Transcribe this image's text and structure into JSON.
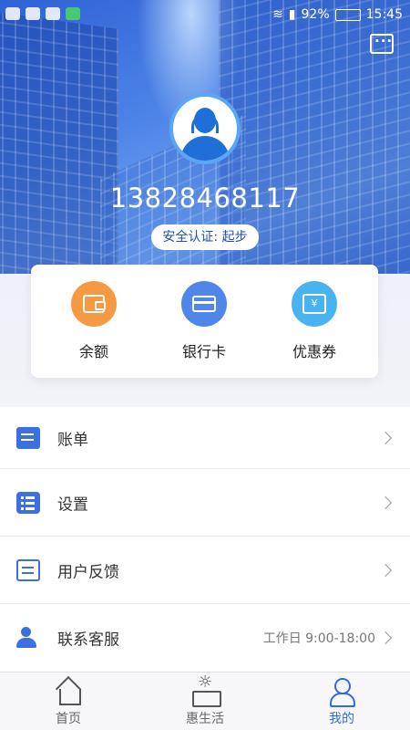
{
  "status_bar": {
    "battery": "92%",
    "time": "15:45"
  },
  "header": {
    "phone": "13828468117",
    "cert_label": "安全认证: 起步",
    "message_icon": "message-icon"
  },
  "wallet": [
    {
      "label": "余额",
      "icon": "wallet-icon",
      "color": "#f59a43"
    },
    {
      "label": "银行卡",
      "icon": "bank-card-icon",
      "color": "#4f86e8"
    },
    {
      "label": "优惠券",
      "icon": "coupon-icon",
      "color": "#49b3f0"
    }
  ],
  "coupon_symbol": "¥",
  "menu": [
    {
      "label": "账单",
      "icon": "bill-icon",
      "extra": ""
    },
    {
      "label": "设置",
      "icon": "settings-icon",
      "extra": ""
    },
    {
      "label": "用户反馈",
      "icon": "feedback-icon",
      "extra": ""
    },
    {
      "label": "联系客服",
      "icon": "customer-service-icon",
      "extra": "工作日 9:00-18:00"
    }
  ],
  "tabs": [
    {
      "label": "首页",
      "icon": "home-icon",
      "active": false
    },
    {
      "label": "惠生活",
      "icon": "life-icon",
      "active": false
    },
    {
      "label": "我的",
      "icon": "profile-icon",
      "active": true
    }
  ],
  "colors": {
    "accent": "#2e6ce0",
    "header_blue": "#3c6fe0"
  }
}
